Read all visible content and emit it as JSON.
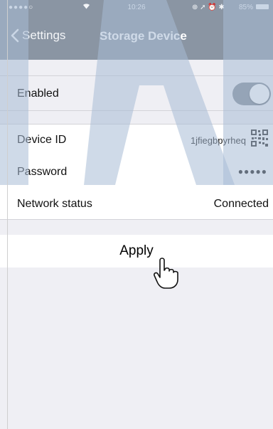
{
  "status_bar": {
    "signal": "●●●●○",
    "time": "10:26",
    "battery": "85%"
  },
  "nav": {
    "back_label": "Settings",
    "title": "Storage Device"
  },
  "enabled": {
    "label": "Enabled",
    "on": true
  },
  "details": [
    {
      "label": "Device ID",
      "value": "1jfiegbpyrheq"
    },
    {
      "label": "Password",
      "value": "●●●●●"
    },
    {
      "label": "Network status",
      "value": "Connected"
    }
  ],
  "apply": {
    "label": "Apply"
  },
  "colors": {
    "bar": "#8a95a3",
    "group_bg": "#efeff4",
    "toggle_on": "#7e8793"
  }
}
